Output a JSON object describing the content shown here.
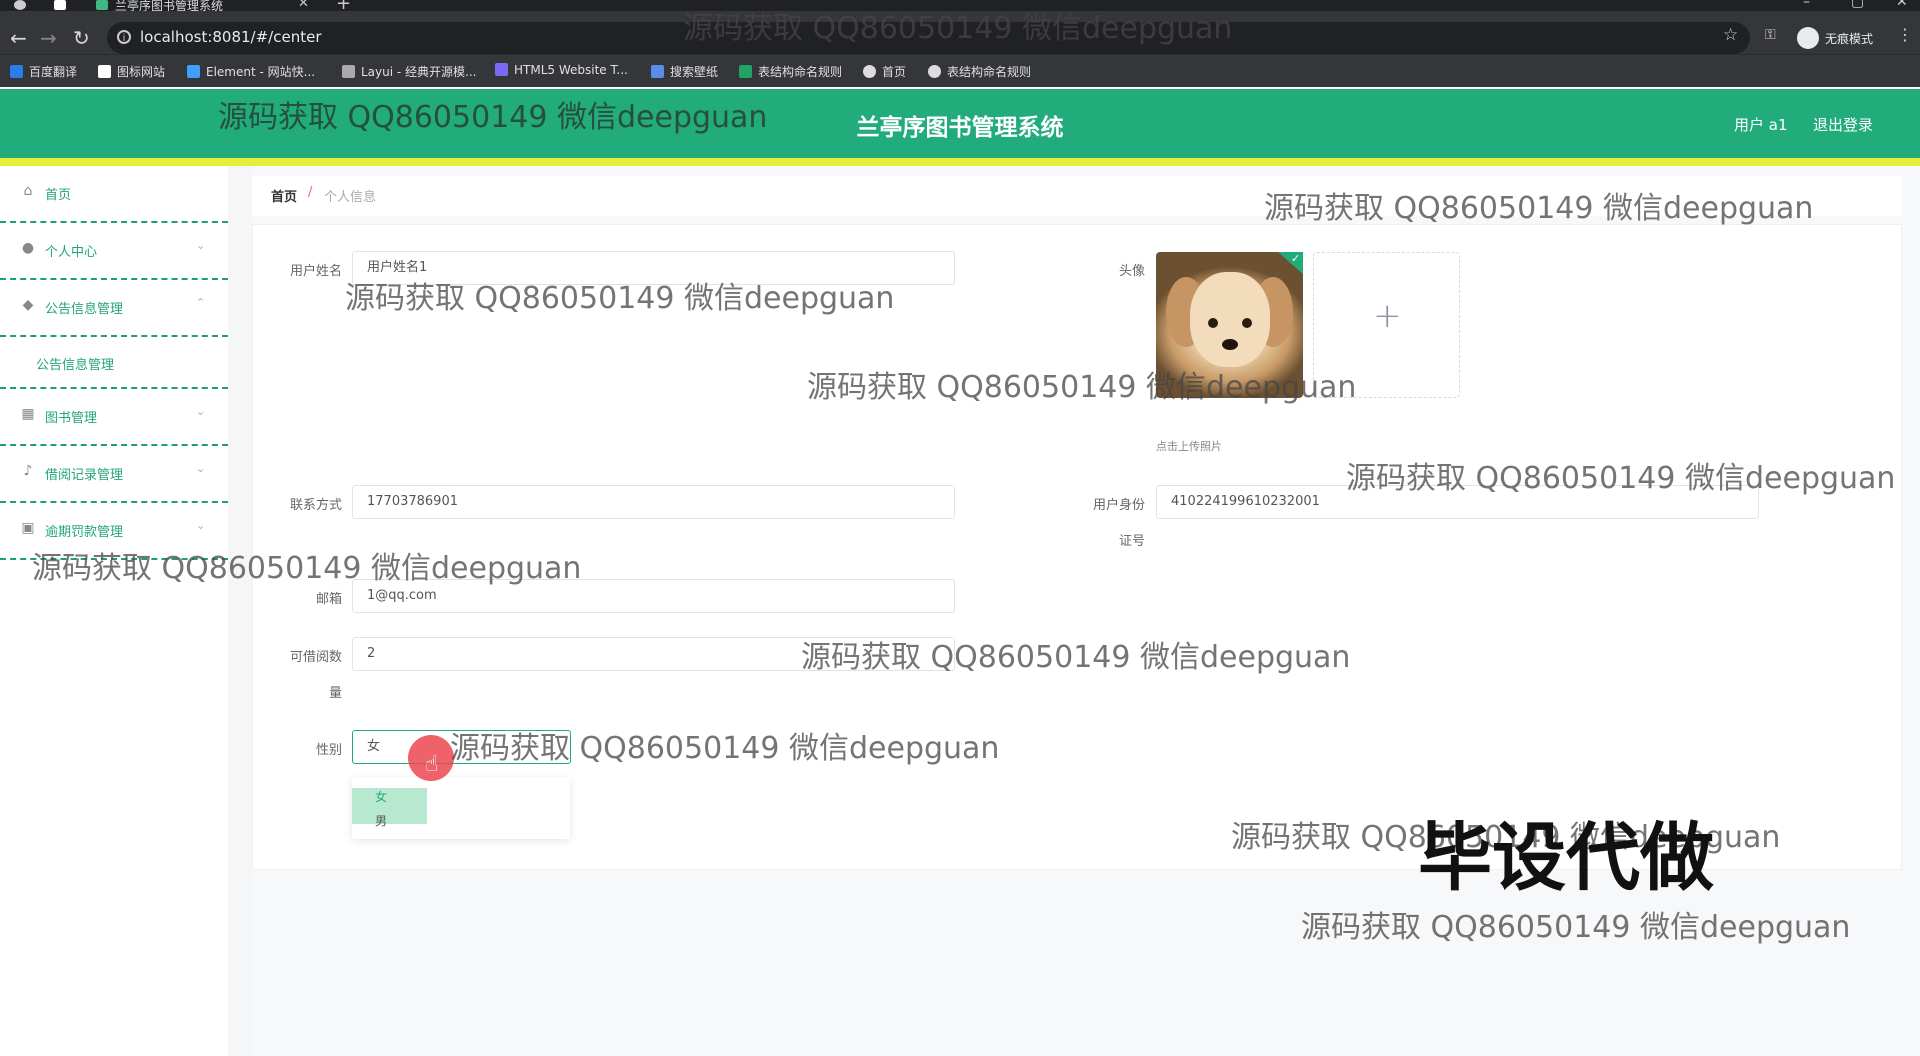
{
  "browser": {
    "tab_title": "兰亭序图书管理系统",
    "url": "localhost:8081/#/center",
    "incognito_label": "无痕模式",
    "bookmarks": [
      "百度翻译",
      "图标网站",
      "Element - 网站快...",
      "Layui - 经典开源模...",
      "HTML5 Website T...",
      "搜索壁纸",
      "表结构命名规则",
      "首页",
      "表结构命名规则"
    ]
  },
  "header": {
    "title": "兰亭序图书管理系统",
    "user": "用户 a1",
    "logout": "退出登录"
  },
  "sidebar": {
    "home": "首页",
    "personal_center": "个人中心",
    "notice_mgmt": "公告信息管理",
    "notice_sub": "公告信息管理",
    "book_mgmt": "图书管理",
    "borrow_mgmt": "借阅记录管理",
    "fine_mgmt": "逾期罚款管理"
  },
  "breadcrumb": {
    "home": "首页",
    "sep": "/",
    "current": "个人信息"
  },
  "form": {
    "username_label": "用户姓名",
    "username_value": "用户姓名1",
    "avatar_label": "头像",
    "upload_hint": "点击上传照片",
    "contact_label": "联系方式",
    "contact_value": "17703786901",
    "idcard_label_1": "用户身份",
    "idcard_label_2": "证号",
    "idcard_value": "410224199610232001",
    "email_label": "邮箱",
    "email_value": "1@qq.com",
    "borrow_label_1": "可借阅数",
    "borrow_label_2": "量",
    "borrow_value": "2",
    "gender_label": "性别",
    "gender_value": "女",
    "gender_options": [
      "女",
      "男"
    ]
  },
  "watermarks": {
    "text": "源码获取 QQ86050149 微信deepguan",
    "big": "毕设代做"
  }
}
